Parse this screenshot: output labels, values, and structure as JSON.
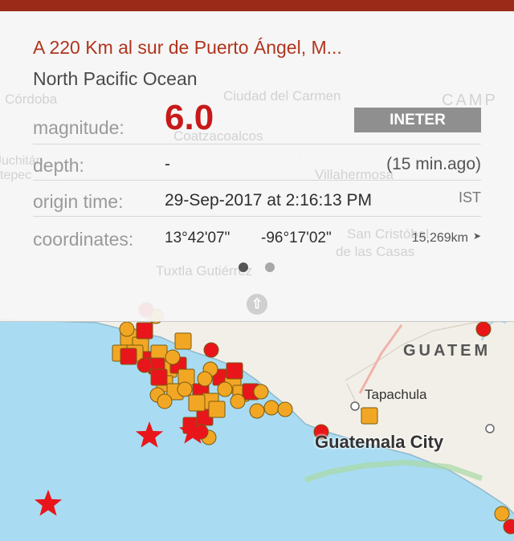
{
  "event": {
    "title": "A 220 Km al sur de Puerto Ángel, M...",
    "region": "North Pacific Ocean",
    "magnitude_label": "magnitude:",
    "magnitude": "6.0",
    "agency": "INETER",
    "depth_label": "depth:",
    "depth": "-",
    "ago": "(15 min.ago)",
    "origin_label": "origin time:",
    "origin_time": "29-Sep-2017 at 2:16:13 PM",
    "timezone": "IST",
    "coords_label": "coordinates:",
    "latitude": "13°42'07\"",
    "longitude": "-96°17'02\"",
    "distance": "15,269km"
  },
  "pager": {
    "pages": 2,
    "active": 1
  },
  "map_labels": {
    "guatemala": "GUATEM",
    "tapachula": "Tapachula",
    "guatemala_city": "Guatemala City",
    "cordoba": "Córdoba",
    "ciudad_del_carmen": "Ciudad del Carmen",
    "campeche": "CAMP",
    "coatzacoalcos": "Coatzacoalcos",
    "villahermosa": "Villahermosa",
    "san_cristobal_1": "San Cristóbal",
    "san_cristobal_2": "de las Casas",
    "tuxtla": "Tuxtla Gutiérrez",
    "juchitan": "Juchitán",
    "tepec": "tepec"
  },
  "colors": {
    "accent": "#b0341d",
    "magnitude": "#c8191a",
    "marker_red": "#e8161b",
    "marker_orange": "#f2a724",
    "ocean": "#a9dcf2",
    "land": "#f2efe8"
  },
  "icons": {
    "location": "location-arrow-icon",
    "expand": "chevron-up-icon",
    "epicenter": "star-icon"
  }
}
